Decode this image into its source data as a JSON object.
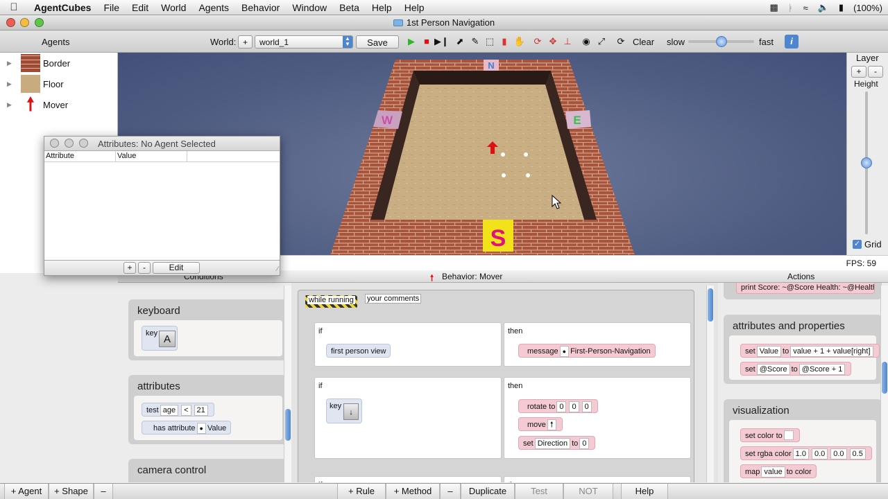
{
  "menubar": {
    "app": "AgentCubes",
    "items": [
      "File",
      "Edit",
      "World",
      "Agents",
      "Behavior",
      "Window",
      "Beta",
      "Help",
      "Help"
    ],
    "battery": "(100%)"
  },
  "window": {
    "title": "1st Person Navigation"
  },
  "toolbar": {
    "agents_label": "Agents",
    "world_label": "World:",
    "add_label": "+",
    "world_value": "world_1",
    "save_label": "Save",
    "clear_label": "Clear",
    "slow_label": "slow",
    "fast_label": "fast",
    "speed_fraction": 0.5
  },
  "agents": [
    {
      "name": "Border",
      "icon": "brick-thumb"
    },
    {
      "name": "Floor",
      "icon": "floor-thumb"
    },
    {
      "name": "Mover",
      "icon": "red-arrow-icon"
    }
  ],
  "world": {
    "signs": {
      "north": "N",
      "south": "S",
      "west": "W",
      "east": "E"
    },
    "fps": "FPS: 59"
  },
  "layer": {
    "title": "Layer",
    "plus": "+",
    "minus": "-",
    "height_label": "Height",
    "grid_label": "Grid",
    "grid_checked": true,
    "height_fraction": 0.5
  },
  "attributes_window": {
    "title": "Attributes: No Agent Selected",
    "col_attribute": "Attribute",
    "col_value": "Value",
    "plus": "+",
    "minus": "-",
    "edit": "Edit"
  },
  "sections": {
    "conditions": "Conditions",
    "behavior": "Behavior: Mover",
    "actions": "Actions"
  },
  "conditions": {
    "keyboard": {
      "title": "keyboard",
      "key_label": "key",
      "key_value": "A"
    },
    "attributes": {
      "title": "attributes",
      "test": {
        "label": "test",
        "attr": "age",
        "op": "<",
        "value": "21"
      },
      "has": {
        "label": "has attribute",
        "value": "Value"
      }
    },
    "camera": {
      "title": "camera control"
    }
  },
  "behavior": {
    "while_running": "while running",
    "comments": "your comments",
    "rules": [
      {
        "if": "if",
        "then": "then",
        "cond": "first person view",
        "action_label": "message",
        "action_value": "First-Person-Navigation"
      },
      {
        "if": "if",
        "then": "then",
        "key_label": "key",
        "rotate_label": "rotate to",
        "rotate_values": [
          "0",
          "0",
          "0"
        ],
        "move_label": "move",
        "set_label": "set",
        "set_attr": "Direction",
        "set_to": "to",
        "set_value": "0"
      },
      {
        "if": "if",
        "then": "then"
      }
    ]
  },
  "actions": {
    "print_text": "print  Score: ~@Score Health: ~@Health",
    "attributes": {
      "title": "attributes and properties",
      "set1": {
        "label": "set",
        "attr": "Value",
        "to": "to",
        "expr": "value + 1 + value[right]"
      },
      "set2": {
        "label": "set",
        "attr": "@Score",
        "to": "to",
        "expr": "@Score + 1"
      }
    },
    "visualization": {
      "title": "visualization",
      "color_label": "set color to",
      "rgba_label": "set rgba color",
      "rgba_values": [
        "1.0",
        "0.0",
        "0.0",
        "0.5"
      ],
      "map_label": "map",
      "map_attr": "value",
      "map_to": "to color"
    }
  },
  "bottom": {
    "add_agent": "+ Agent",
    "add_shape": "+ Shape",
    "minus": "–",
    "add_rule": "+ Rule",
    "add_method": "+ Method",
    "minus2": "–",
    "duplicate": "Duplicate",
    "test": "Test",
    "not": "NOT",
    "help": "Help"
  }
}
